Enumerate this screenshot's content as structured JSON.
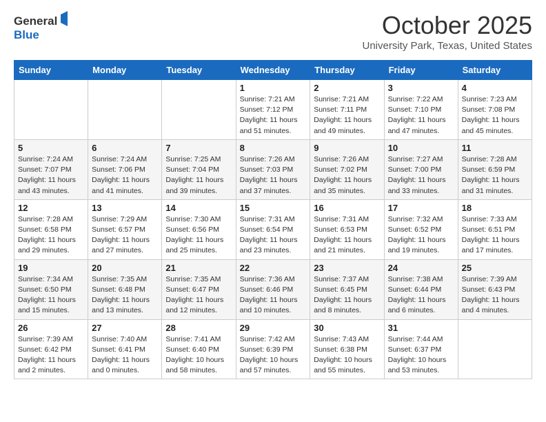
{
  "header": {
    "logo_general": "General",
    "logo_blue": "Blue",
    "month": "October 2025",
    "location": "University Park, Texas, United States"
  },
  "weekdays": [
    "Sunday",
    "Monday",
    "Tuesday",
    "Wednesday",
    "Thursday",
    "Friday",
    "Saturday"
  ],
  "weeks": [
    [
      {
        "day": "",
        "info": ""
      },
      {
        "day": "",
        "info": ""
      },
      {
        "day": "",
        "info": ""
      },
      {
        "day": "1",
        "info": "Sunrise: 7:21 AM\nSunset: 7:12 PM\nDaylight: 11 hours\nand 51 minutes."
      },
      {
        "day": "2",
        "info": "Sunrise: 7:21 AM\nSunset: 7:11 PM\nDaylight: 11 hours\nand 49 minutes."
      },
      {
        "day": "3",
        "info": "Sunrise: 7:22 AM\nSunset: 7:10 PM\nDaylight: 11 hours\nand 47 minutes."
      },
      {
        "day": "4",
        "info": "Sunrise: 7:23 AM\nSunset: 7:08 PM\nDaylight: 11 hours\nand 45 minutes."
      }
    ],
    [
      {
        "day": "5",
        "info": "Sunrise: 7:24 AM\nSunset: 7:07 PM\nDaylight: 11 hours\nand 43 minutes."
      },
      {
        "day": "6",
        "info": "Sunrise: 7:24 AM\nSunset: 7:06 PM\nDaylight: 11 hours\nand 41 minutes."
      },
      {
        "day": "7",
        "info": "Sunrise: 7:25 AM\nSunset: 7:04 PM\nDaylight: 11 hours\nand 39 minutes."
      },
      {
        "day": "8",
        "info": "Sunrise: 7:26 AM\nSunset: 7:03 PM\nDaylight: 11 hours\nand 37 minutes."
      },
      {
        "day": "9",
        "info": "Sunrise: 7:26 AM\nSunset: 7:02 PM\nDaylight: 11 hours\nand 35 minutes."
      },
      {
        "day": "10",
        "info": "Sunrise: 7:27 AM\nSunset: 7:00 PM\nDaylight: 11 hours\nand 33 minutes."
      },
      {
        "day": "11",
        "info": "Sunrise: 7:28 AM\nSunset: 6:59 PM\nDaylight: 11 hours\nand 31 minutes."
      }
    ],
    [
      {
        "day": "12",
        "info": "Sunrise: 7:28 AM\nSunset: 6:58 PM\nDaylight: 11 hours\nand 29 minutes."
      },
      {
        "day": "13",
        "info": "Sunrise: 7:29 AM\nSunset: 6:57 PM\nDaylight: 11 hours\nand 27 minutes."
      },
      {
        "day": "14",
        "info": "Sunrise: 7:30 AM\nSunset: 6:56 PM\nDaylight: 11 hours\nand 25 minutes."
      },
      {
        "day": "15",
        "info": "Sunrise: 7:31 AM\nSunset: 6:54 PM\nDaylight: 11 hours\nand 23 minutes."
      },
      {
        "day": "16",
        "info": "Sunrise: 7:31 AM\nSunset: 6:53 PM\nDaylight: 11 hours\nand 21 minutes."
      },
      {
        "day": "17",
        "info": "Sunrise: 7:32 AM\nSunset: 6:52 PM\nDaylight: 11 hours\nand 19 minutes."
      },
      {
        "day": "18",
        "info": "Sunrise: 7:33 AM\nSunset: 6:51 PM\nDaylight: 11 hours\nand 17 minutes."
      }
    ],
    [
      {
        "day": "19",
        "info": "Sunrise: 7:34 AM\nSunset: 6:50 PM\nDaylight: 11 hours\nand 15 minutes."
      },
      {
        "day": "20",
        "info": "Sunrise: 7:35 AM\nSunset: 6:48 PM\nDaylight: 11 hours\nand 13 minutes."
      },
      {
        "day": "21",
        "info": "Sunrise: 7:35 AM\nSunset: 6:47 PM\nDaylight: 11 hours\nand 12 minutes."
      },
      {
        "day": "22",
        "info": "Sunrise: 7:36 AM\nSunset: 6:46 PM\nDaylight: 11 hours\nand 10 minutes."
      },
      {
        "day": "23",
        "info": "Sunrise: 7:37 AM\nSunset: 6:45 PM\nDaylight: 11 hours\nand 8 minutes."
      },
      {
        "day": "24",
        "info": "Sunrise: 7:38 AM\nSunset: 6:44 PM\nDaylight: 11 hours\nand 6 minutes."
      },
      {
        "day": "25",
        "info": "Sunrise: 7:39 AM\nSunset: 6:43 PM\nDaylight: 11 hours\nand 4 minutes."
      }
    ],
    [
      {
        "day": "26",
        "info": "Sunrise: 7:39 AM\nSunset: 6:42 PM\nDaylight: 11 hours\nand 2 minutes."
      },
      {
        "day": "27",
        "info": "Sunrise: 7:40 AM\nSunset: 6:41 PM\nDaylight: 11 hours\nand 0 minutes."
      },
      {
        "day": "28",
        "info": "Sunrise: 7:41 AM\nSunset: 6:40 PM\nDaylight: 10 hours\nand 58 minutes."
      },
      {
        "day": "29",
        "info": "Sunrise: 7:42 AM\nSunset: 6:39 PM\nDaylight: 10 hours\nand 57 minutes."
      },
      {
        "day": "30",
        "info": "Sunrise: 7:43 AM\nSunset: 6:38 PM\nDaylight: 10 hours\nand 55 minutes."
      },
      {
        "day": "31",
        "info": "Sunrise: 7:44 AM\nSunset: 6:37 PM\nDaylight: 10 hours\nand 53 minutes."
      },
      {
        "day": "",
        "info": ""
      }
    ]
  ]
}
